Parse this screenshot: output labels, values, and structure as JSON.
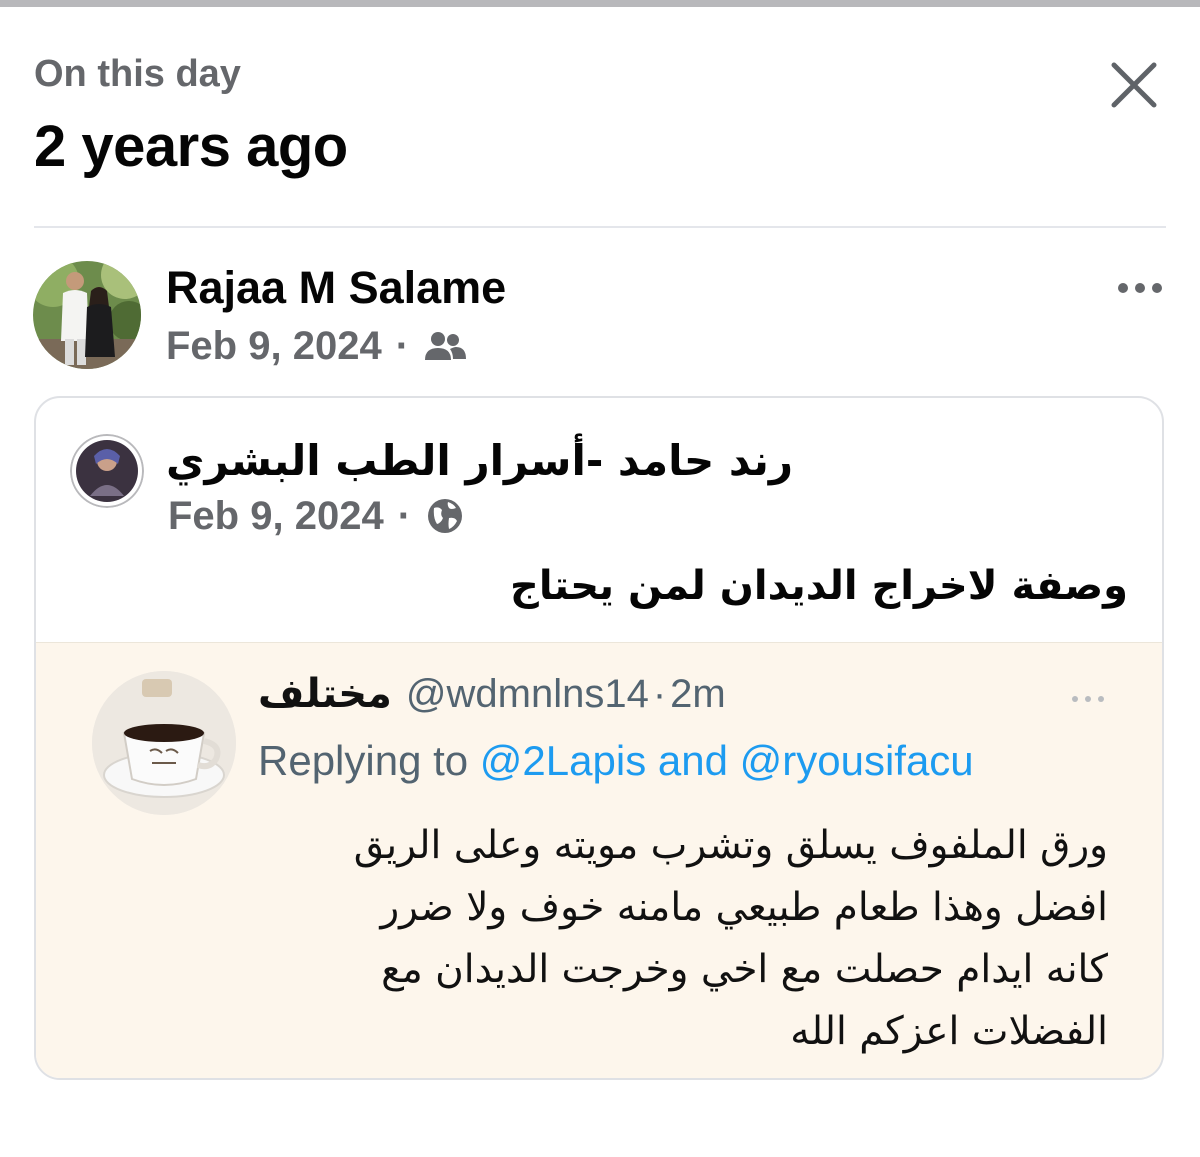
{
  "header": {
    "kicker": "On this day",
    "title": "2 years ago"
  },
  "post": {
    "author": "Rajaa M Salame",
    "date": "Feb 9, 2024",
    "separator": "·",
    "audience_icon": "friends-icon",
    "more_icon": "more-horizontal-icon"
  },
  "shared": {
    "page_name": "رند حامد -أسرار الطب البشري",
    "date": "Feb 9, 2024",
    "separator": "·",
    "audience_icon": "globe-icon",
    "text": "وصفة لاخراج الديدان لمن يحتاج",
    "tweet": {
      "display_name": "مختلف",
      "handle": "@wdmnlns14",
      "separator": "·",
      "time": "2m",
      "replying_label": "Replying to",
      "replying_mentions": "@2Lapis and @ryousifacu",
      "body_lines": [
        "ورق الملفوف يسلق وتشرب مويته وعلى الريق",
        "افضل وهذا طعام طبيعي مامنه خوف ولا ضرر",
        "كانه ايدام حصلت مع اخي وخرجت الديدان مع",
        "الفضلات اعزكم الله"
      ]
    }
  },
  "colors": {
    "secondary_text": "#65676b",
    "twitter_blue": "#1d9bf0",
    "quote_background": "#fdf6ec",
    "card_border": "#dfe1e5"
  }
}
